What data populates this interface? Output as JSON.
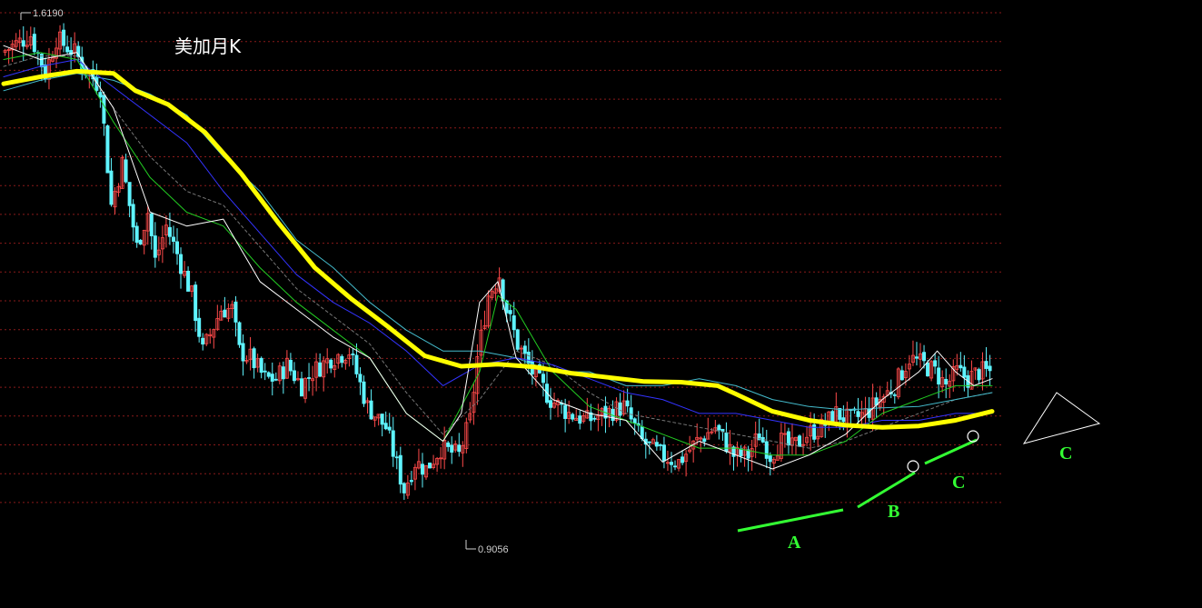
{
  "chart_data": {
    "type": "candlestick",
    "title": "美加月K",
    "high_label": "1.6190",
    "low_label": "0.9056",
    "grid": true,
    "ylim": [
      0.87,
      1.64
    ],
    "annotations": [
      "A",
      "B",
      "C",
      "C"
    ],
    "colors": {
      "background": "#000000",
      "grid": "#8a1a1a",
      "bear": "#5ff4ff",
      "bull": "#ff4a4a",
      "ma_main": "#ffff00",
      "ma_white": "#ffffff",
      "ma_green": "#22cc22",
      "ma_blue": "#3333ff",
      "ma_cyan": "#44bbcc",
      "ma_gray": "#777777",
      "annotation": "#33ff33"
    },
    "ma_main": {
      "x": [
        0,
        10,
        20,
        30,
        36,
        45,
        55,
        65,
        75,
        85,
        95,
        105,
        115,
        125,
        135,
        145,
        155,
        165,
        175,
        185,
        195,
        200,
        210,
        220,
        230,
        240,
        250,
        260,
        270
      ],
      "y": [
        1.535,
        1.545,
        1.553,
        1.55,
        1.525,
        1.505,
        1.465,
        1.405,
        1.335,
        1.27,
        1.225,
        1.185,
        1.143,
        1.128,
        1.131,
        1.127,
        1.118,
        1.112,
        1.106,
        1.105,
        1.1,
        1.088,
        1.063,
        1.05,
        1.043,
        1.04,
        1.042,
        1.05,
        1.063
      ]
    },
    "ma_white": {
      "x": [
        0,
        10,
        20,
        30,
        40,
        50,
        60,
        70,
        80,
        90,
        100,
        110,
        120,
        125,
        130,
        135,
        140,
        150,
        160,
        170,
        180,
        190,
        200,
        210,
        220,
        230,
        240,
        250,
        255,
        260,
        265,
        270
      ],
      "y": [
        1.59,
        1.57,
        1.58,
        1.5,
        1.35,
        1.33,
        1.34,
        1.25,
        1.21,
        1.17,
        1.14,
        1.06,
        1.02,
        1.06,
        1.22,
        1.25,
        1.14,
        1.08,
        1.06,
        1.05,
        0.99,
        1.02,
        1.0,
        0.98,
        1.0,
        1.03,
        1.08,
        1.12,
        1.15,
        1.12,
        1.1,
        1.11
      ]
    },
    "ma_green": {
      "x": [
        0,
        10,
        20,
        30,
        40,
        50,
        60,
        70,
        80,
        90,
        100,
        110,
        120,
        130,
        135,
        140,
        150,
        160,
        170,
        180,
        190,
        200,
        210,
        220,
        230,
        240,
        250,
        260,
        270
      ],
      "y": [
        1.57,
        1.58,
        1.57,
        1.48,
        1.4,
        1.35,
        1.33,
        1.27,
        1.22,
        1.18,
        1.14,
        1.06,
        1.02,
        1.12,
        1.23,
        1.21,
        1.12,
        1.07,
        1.05,
        1.03,
        1.01,
        1.01,
        1.0,
        1.0,
        1.02,
        1.06,
        1.08,
        1.1,
        1.1
      ]
    },
    "ma_blue": {
      "x": [
        0,
        10,
        20,
        30,
        40,
        50,
        60,
        70,
        80,
        90,
        100,
        110,
        120,
        130,
        140,
        150,
        160,
        170,
        180,
        190,
        200,
        210,
        220,
        230,
        240,
        250,
        260,
        270
      ],
      "y": [
        1.545,
        1.56,
        1.57,
        1.53,
        1.49,
        1.45,
        1.38,
        1.32,
        1.26,
        1.22,
        1.19,
        1.15,
        1.1,
        1.13,
        1.14,
        1.13,
        1.11,
        1.09,
        1.08,
        1.06,
        1.06,
        1.05,
        1.04,
        1.04,
        1.05,
        1.05,
        1.06,
        1.06
      ]
    },
    "ma_cyan": {
      "x": [
        0,
        10,
        20,
        30,
        40,
        50,
        60,
        70,
        80,
        90,
        100,
        110,
        120,
        130,
        140,
        150,
        160,
        170,
        180,
        190,
        200,
        210,
        220,
        230,
        240,
        250,
        260,
        270
      ],
      "y": [
        1.525,
        1.54,
        1.55,
        1.54,
        1.52,
        1.49,
        1.43,
        1.38,
        1.31,
        1.27,
        1.22,
        1.18,
        1.15,
        1.15,
        1.14,
        1.12,
        1.12,
        1.1,
        1.1,
        1.11,
        1.1,
        1.08,
        1.07,
        1.065,
        1.068,
        1.07,
        1.08,
        1.09
      ]
    },
    "ma_gray": {
      "x": [
        0,
        10,
        20,
        30,
        40,
        50,
        60,
        70,
        80,
        90,
        100,
        110,
        120,
        130,
        140,
        150,
        160,
        170,
        180,
        190,
        200,
        210,
        220,
        230,
        240,
        250,
        260,
        270
      ],
      "y": [
        1.56,
        1.575,
        1.575,
        1.5,
        1.43,
        1.38,
        1.36,
        1.3,
        1.24,
        1.2,
        1.16,
        1.09,
        1.03,
        1.08,
        1.15,
        1.13,
        1.09,
        1.06,
        1.05,
        1.04,
        1.03,
        1.02,
        1.01,
        1.02,
        1.04,
        1.06,
        1.08,
        1.09
      ]
    },
    "price_path": {
      "x": [
        0,
        8,
        12,
        15,
        20,
        24,
        27,
        30,
        33,
        37,
        40,
        42,
        45,
        48,
        52,
        55,
        60,
        63,
        65,
        68,
        72,
        75,
        78,
        82,
        85,
        90,
        95,
        100,
        105,
        110,
        113,
        116,
        120,
        125,
        128,
        130,
        133,
        136,
        138,
        141,
        145,
        150,
        155,
        160,
        165,
        170,
        175,
        180,
        185,
        190,
        195,
        200,
        204,
        207,
        210,
        213,
        216,
        220,
        224,
        228,
        232,
        236,
        240,
        244,
        248,
        252,
        255,
        258,
        261,
        264,
        267,
        270
      ],
      "y": [
        1.58,
        1.605,
        1.55,
        1.6,
        1.58,
        1.55,
        1.53,
        1.36,
        1.42,
        1.3,
        1.35,
        1.28,
        1.33,
        1.29,
        1.23,
        1.15,
        1.21,
        1.21,
        1.15,
        1.14,
        1.11,
        1.11,
        1.13,
        1.1,
        1.12,
        1.14,
        1.15,
        1.07,
        1.04,
        0.95,
        0.99,
        0.98,
        1.01,
        1.0,
        1.05,
        1.14,
        1.23,
        1.26,
        1.21,
        1.16,
        1.12,
        1.08,
        1.06,
        1.05,
        1.06,
        1.07,
        1.02,
        1.0,
        0.99,
        1.02,
        1.04,
        1.0,
        1.0,
        1.03,
        1.0,
        1.02,
        1.01,
        1.03,
        1.04,
        1.06,
        1.05,
        1.06,
        1.08,
        1.1,
        1.14,
        1.13,
        1.12,
        1.1,
        1.12,
        1.11,
        1.12,
        1.12
      ]
    },
    "candle_count": 270
  }
}
